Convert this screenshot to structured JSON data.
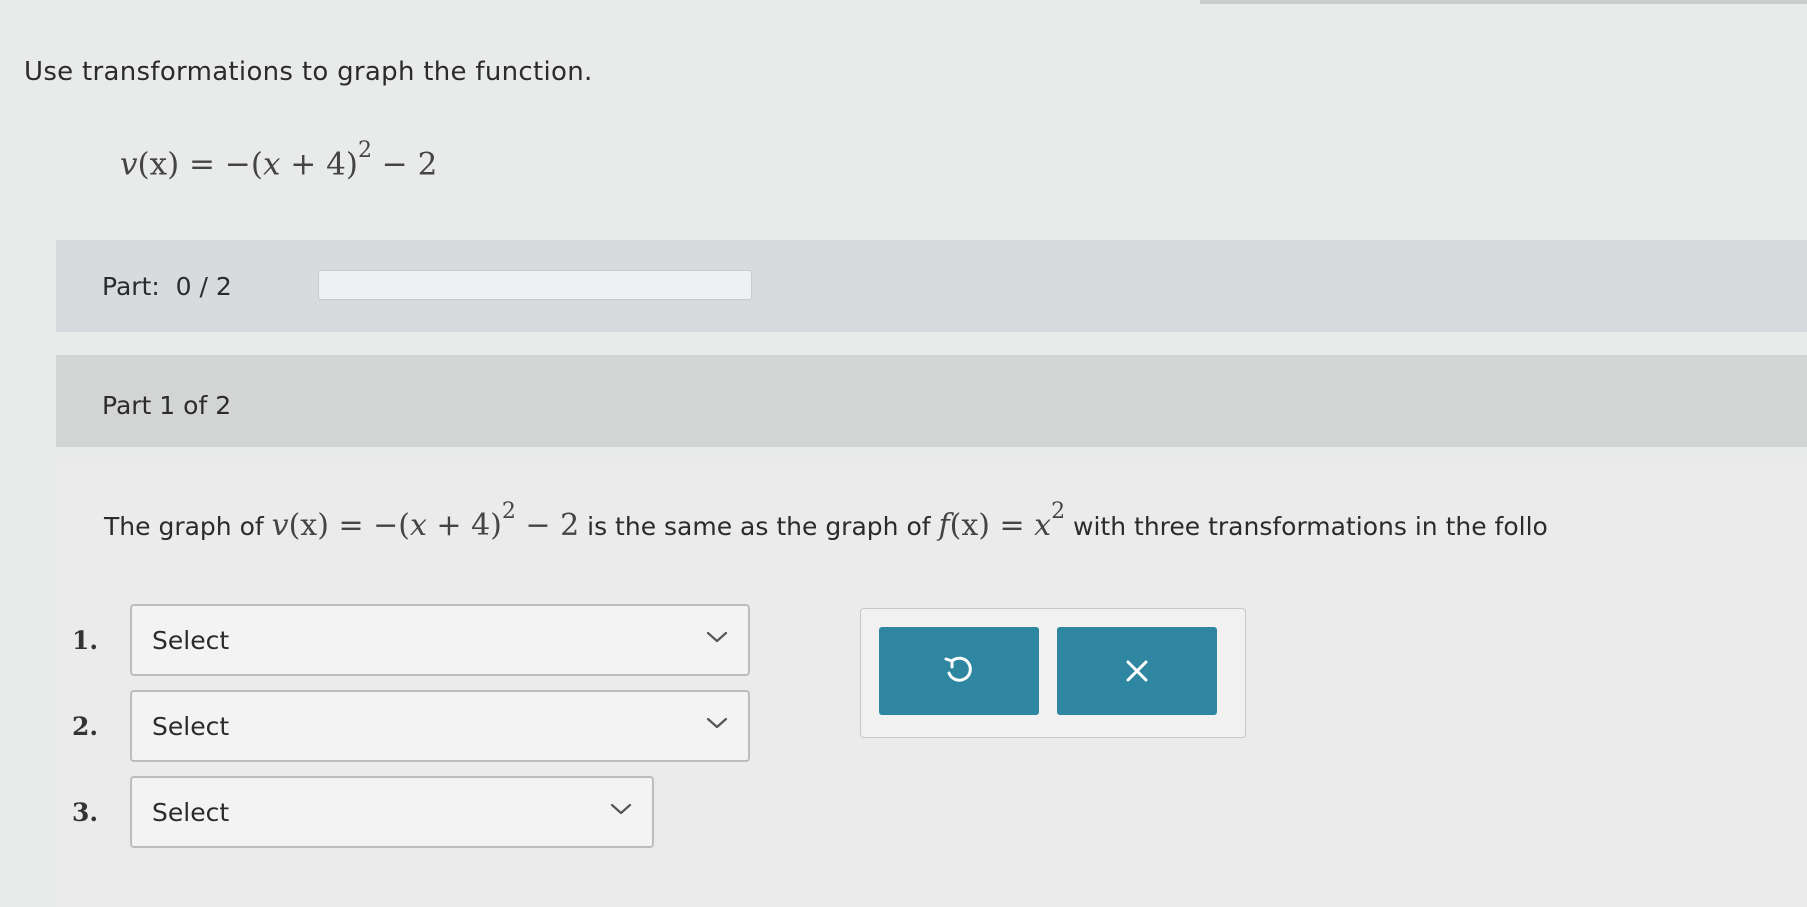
{
  "instructions": "Use transformations to graph the function.",
  "function_display": {
    "lhs": "v",
    "arg": "(x)",
    "eq": " = −(",
    "inner": "x",
    "plus": " + 4)",
    "exp": "2",
    "tail": " − 2"
  },
  "part_progress": {
    "label": "Part:  0 / 2",
    "completed": 0,
    "total": 2
  },
  "part_header": {
    "label": "Part 1 of 2"
  },
  "question": {
    "prefix": "The graph of ",
    "v_func": {
      "lhs": "v",
      "arg": "(x)",
      "eq": " = −(",
      "inner": "x",
      "plus": " + 4)",
      "exp": "2",
      "tail": " − 2"
    },
    "middle": " is the same as the graph of ",
    "f_func": {
      "lhs": "f",
      "arg": "(x)",
      "eq": " = ",
      "base": "x",
      "exp": "2"
    },
    "suffix": " with three transformations in the follo"
  },
  "answers": [
    {
      "number": "1.",
      "value": "Select"
    },
    {
      "number": "2.",
      "value": "Select"
    },
    {
      "number": "3.",
      "value": "Select"
    }
  ],
  "buttons": {
    "undo_icon": "undo-icon",
    "clear_icon": "close-icon"
  },
  "colors": {
    "button_teal": "#2e86a0",
    "background": "#e9eaea",
    "progress_bar": "#d7dbde",
    "part_header": "#d3d4d4"
  }
}
